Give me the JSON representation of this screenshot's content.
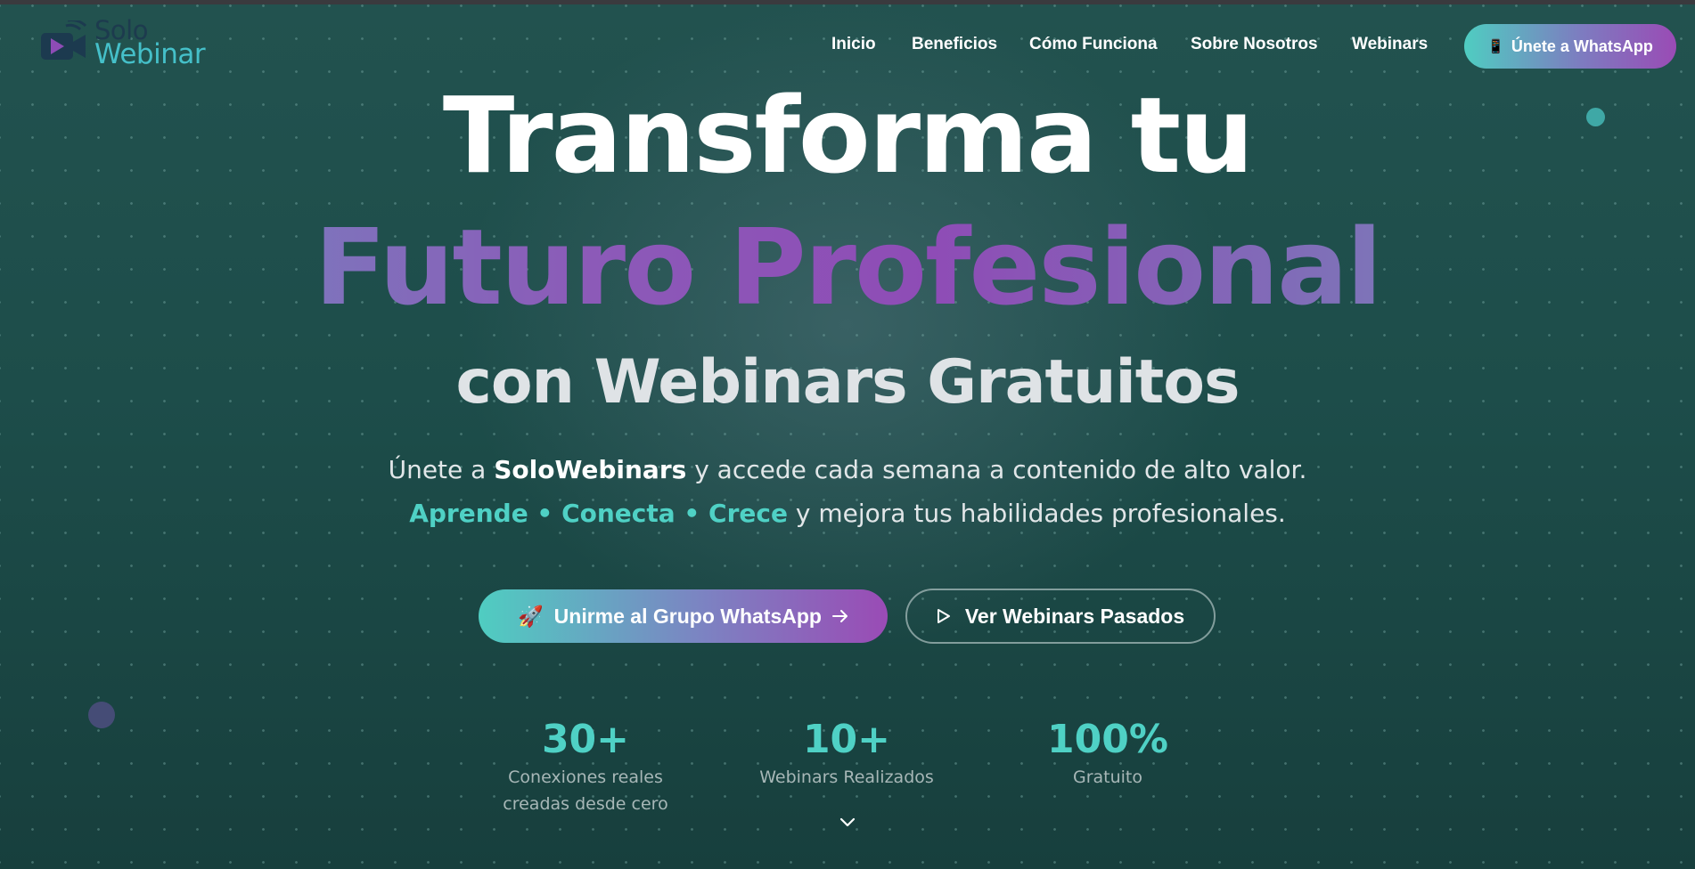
{
  "brand": {
    "line1": "Solo",
    "line2": "Webinar"
  },
  "nav": {
    "items": [
      {
        "label": "Inicio"
      },
      {
        "label": "Beneficios"
      },
      {
        "label": "Cómo Funciona"
      },
      {
        "label": "Sobre Nosotros"
      },
      {
        "label": "Webinars"
      }
    ],
    "cta_label": "Únete a WhatsApp",
    "cta_icon": "mobile-phone-icon"
  },
  "hero": {
    "title_line1": "Transforma tu",
    "title_line2": "Futuro Profesional",
    "title_line3": "con Webinars Gratuitos",
    "sub1_prefix": "Únete a",
    "sub1_brand": "SoloWebinars",
    "sub1_suffix": "y accede cada semana a contenido de alto valor.",
    "sub2_highlight": "Aprende • Conecta • Crece",
    "sub2_suffix": "y mejora tus habilidades profesionales."
  },
  "buttons": {
    "primary_emoji": "🚀",
    "primary_label": "Unirme al Grupo WhatsApp",
    "secondary_label": "Ver Webinars Pasados"
  },
  "stats": [
    {
      "value": "30+",
      "label": "Conexiones reales creadas desde cero"
    },
    {
      "value": "10+",
      "label": "Webinars Realizados"
    },
    {
      "value": "100%",
      "label": "Gratuito"
    }
  ],
  "colors": {
    "accent_teal": "#4fd1c5",
    "accent_purple": "#8e4cb6",
    "background": "#1d4d4a"
  }
}
